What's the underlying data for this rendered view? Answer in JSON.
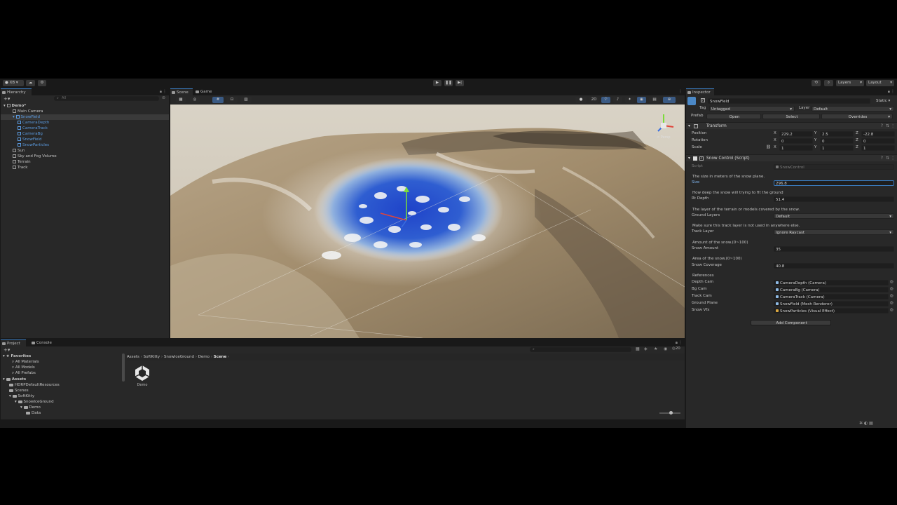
{
  "toolbar": {
    "account": "XB",
    "layers": "Layers",
    "layout": "Layout"
  },
  "hierarchy": {
    "tab": "Hierarchy",
    "search_placeholder": "All",
    "items": [
      {
        "label": "Demo*",
        "indent": 0
      },
      {
        "label": "Main Camera",
        "indent": 1
      },
      {
        "label": "SnowField",
        "indent": 1
      },
      {
        "label": "CameraDepth",
        "indent": 2
      },
      {
        "label": "CameraTrack",
        "indent": 2
      },
      {
        "label": "CameraBg",
        "indent": 2
      },
      {
        "label": "SnowField",
        "indent": 2
      },
      {
        "label": "SnowParticles",
        "indent": 2
      },
      {
        "label": "Sun",
        "indent": 1
      },
      {
        "label": "Sky and Fog Volume",
        "indent": 1
      },
      {
        "label": "Terrain",
        "indent": 1
      },
      {
        "label": "Track",
        "indent": 1
      }
    ]
  },
  "scene": {
    "tab_scene": "Scene",
    "tab_game": "Game",
    "mode_2d": "2D",
    "gizmo_label": "< Persp"
  },
  "inspector": {
    "tab": "Inspector",
    "object_name": "SnowField",
    "static_label": "Static",
    "tag_label": "Tag",
    "tag_value": "Untagged",
    "layer_label": "Layer",
    "layer_value": "Default",
    "prefab_label": "Prefab",
    "prefab_open": "Open",
    "prefab_select": "Select",
    "prefab_overrides": "Overrides",
    "transform": {
      "title": "Transform",
      "position_label": "Position",
      "rotation_label": "Rotation",
      "scale_label": "Scale",
      "position": {
        "x": "229.2",
        "y": "2.5",
        "z": "-22.8"
      },
      "rotation": {
        "x": "0",
        "y": "0",
        "z": "0"
      },
      "scale": {
        "x": "1",
        "y": "1",
        "z": "1"
      }
    },
    "snow_control": {
      "title": "Snow Control (Script)",
      "script_label": "Script",
      "script_value": "SnowControl",
      "size_desc": "The size in meters of the snow plane.",
      "size_label": "Size",
      "size_value": "296.8",
      "depth_desc": "How deep the snow will trying to fit the ground",
      "depth_label": "Rt Depth",
      "depth_value": "51.4",
      "ground_desc": "The layer of the terrain or models covered by the snow.",
      "ground_label": "Ground Layers",
      "ground_value": "Default",
      "track_desc": "Make sure this track layer is not used in anywhere else.",
      "track_label": "Track Layer",
      "track_value": "Ignore Raycast",
      "amount_desc": "Amount of the snow.(0~100)",
      "amount_label": "Snow Amount",
      "amount_value": "35",
      "coverage_desc": "Area of the snow.(0~100)",
      "coverage_label": "Snow Coverage",
      "coverage_value": "40.8",
      "references_label": "References",
      "refs": [
        {
          "label": "Depth Cam",
          "value": "CameraDepth (Camera)"
        },
        {
          "label": "Bg Cam",
          "value": "CameraBg (Camera)"
        },
        {
          "label": "Track Cam",
          "value": "CameraTrack (Camera)"
        },
        {
          "label": "Ground Plane",
          "value": "SnowField (Mesh Renderer)"
        },
        {
          "label": "Snow Vfx",
          "value": "SnowParticles (Visual Effect)"
        }
      ]
    },
    "add_component": "Add Component"
  },
  "project": {
    "tab_project": "Project",
    "tab_console": "Console",
    "count": "20",
    "favorites_label": "Favorites",
    "favorites": [
      "All Materials",
      "All Models",
      "All Prefabs"
    ],
    "assets_label": "Assets",
    "tree": [
      {
        "label": "HDRPDefaultResources",
        "indent": 1
      },
      {
        "label": "Scenes",
        "indent": 1
      },
      {
        "label": "SoftKitty",
        "indent": 1
      },
      {
        "label": "SnowIceGround",
        "indent": 2
      },
      {
        "label": "Demo",
        "indent": 3
      },
      {
        "label": "Data",
        "indent": 4
      }
    ],
    "breadcrumb": [
      "Assets",
      "SoftKitty",
      "SnowIceGround",
      "Demo",
      "Scene"
    ],
    "asset_name": "Demo"
  },
  "colors": {
    "panel": "#282828",
    "background": "#191919",
    "accent": "#3a79bb",
    "link_blue": "#5b9be0"
  }
}
